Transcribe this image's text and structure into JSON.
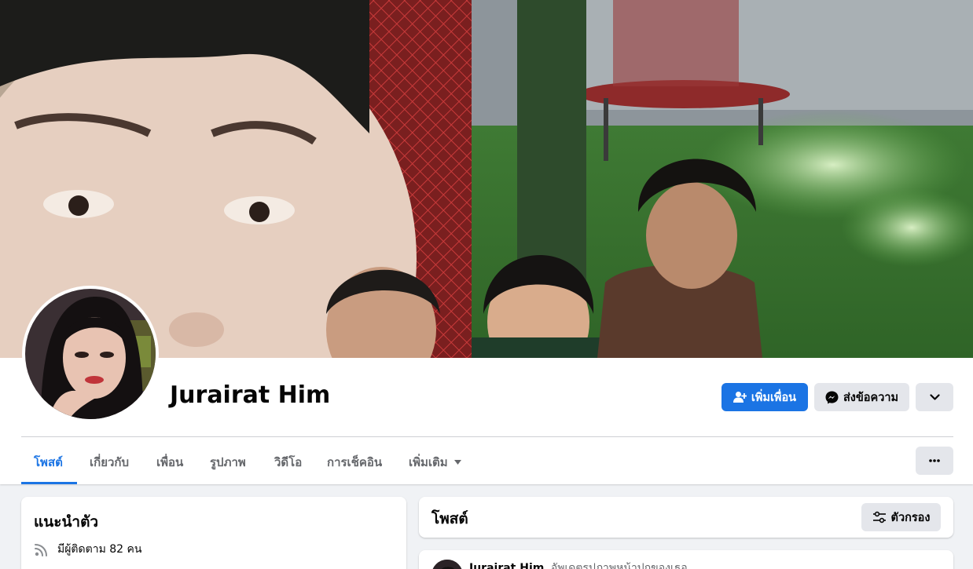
{
  "profile": {
    "name": "Jurairat Him"
  },
  "actions": {
    "add_friend": "เพิ่มเพื่อน",
    "message": "ส่งข้อความ"
  },
  "tabs": [
    {
      "label": "โพสต์",
      "active": true
    },
    {
      "label": "เกี่ยวกับ",
      "active": false
    },
    {
      "label": "เพื่อน",
      "active": false
    },
    {
      "label": "รูปภาพ",
      "active": false
    },
    {
      "label": "วิดีโอ",
      "active": false
    },
    {
      "label": "การเช็คอิน",
      "active": false
    },
    {
      "label": "เพิ่มเติม",
      "active": false
    }
  ],
  "intro": {
    "title": "แนะนำตัว",
    "followers_text": "มีผู้ติดตาม 82 คน"
  },
  "posts": {
    "title": "โพสต์",
    "filter_label": "ตัวกรอง"
  },
  "post": {
    "author": "Jurairat Him",
    "action": "อัพเดตรูปภาพหน้าปกของเธอ"
  },
  "icons": {
    "add_friend": "person-plus-icon",
    "message": "messenger-icon",
    "dropdown": "chevron-down-icon",
    "more": "more-dots-icon",
    "follow": "rss-feed-icon",
    "filter": "sliders-icon",
    "tab_more": "caret-down-icon"
  },
  "colors": {
    "accent": "#1b74e4",
    "secondary_button": "#e4e6eb",
    "page_background": "#f0f2f5",
    "muted_text": "#65676b"
  }
}
